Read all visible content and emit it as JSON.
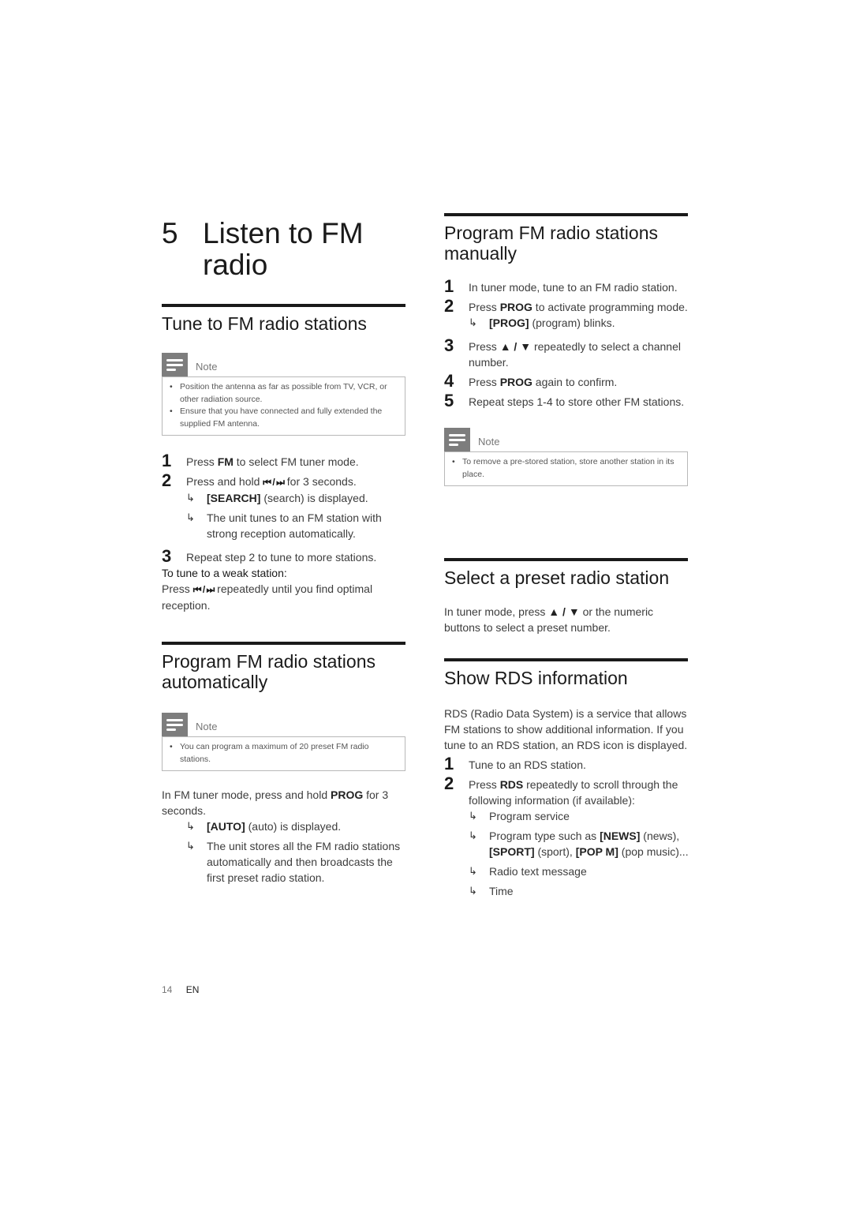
{
  "chapter": {
    "number": "5",
    "title": "Listen to FM radio"
  },
  "left": {
    "tune": {
      "heading": "Tune to FM radio stations",
      "note_label": "Note",
      "notes": [
        "Position the antenna as far as possible from TV, VCR, or other radiation source.",
        "Ensure that you have connected and fully extended the supplied FM antenna."
      ],
      "steps": [
        {
          "num": "1",
          "pre": "Press ",
          "key": "FM",
          "post": " to select FM tuner mode."
        },
        {
          "num": "2",
          "pre": "Press and hold ",
          "key": "⏮ / ⏭",
          "post": " for 3 seconds."
        },
        {
          "num": "3",
          "text": "Repeat step 2 to tune to more stations."
        }
      ],
      "step2_results": [
        {
          "key": "[SEARCH]",
          "text": " (search) is displayed."
        },
        {
          "text": "The unit tunes to an FM station with strong reception automatically."
        }
      ],
      "weak_heading": "To tune to a weak station:",
      "weak_pre": "Press ",
      "weak_key": "⏮ / ⏭",
      "weak_post": " repeatedly until you find optimal reception."
    },
    "auto": {
      "heading": "Program FM radio stations automatically",
      "note_label": "Note",
      "notes": [
        "You can program a maximum of 20 preset FM radio stations."
      ],
      "intro_pre": "In FM tuner mode, press and hold ",
      "intro_key": "PROG",
      "intro_post": " for 3 seconds.",
      "results": [
        {
          "key": "[AUTO]",
          "text": " (auto) is displayed."
        },
        {
          "text": "The unit stores all the FM radio stations automatically and then broadcasts the first preset radio station."
        }
      ]
    }
  },
  "right": {
    "manual": {
      "heading": "Program FM radio stations manually",
      "steps": [
        {
          "num": "1",
          "text": "In tuner mode, tune to an FM radio station."
        },
        {
          "num": "2",
          "pre": "Press ",
          "key": "PROG",
          "post": " to activate programming mode."
        },
        {
          "num": "3",
          "pre": "Press ",
          "key": "▲ / ▼",
          "post": " repeatedly to select a channel number."
        },
        {
          "num": "4",
          "pre": "Press ",
          "key": "PROG",
          "post": " again to confirm."
        },
        {
          "num": "5",
          "text": "Repeat steps 1-4 to store other FM stations."
        }
      ],
      "step2_result": {
        "key": "[PROG]",
        "text": " (program) blinks."
      },
      "note_label": "Note",
      "notes": [
        "To remove a pre-stored station, store another station in its place."
      ]
    },
    "preset": {
      "heading": "Select a preset radio station",
      "pre": "In tuner mode, press ",
      "key": "▲ / ▼",
      "post": " or the numeric buttons to select a preset number."
    },
    "rds": {
      "heading": "Show RDS information",
      "intro": "RDS (Radio Data System) is a service that allows FM stations to show additional information. If you tune to an RDS station, an RDS icon is displayed.",
      "steps": [
        {
          "num": "1",
          "text": "Tune to an RDS station."
        },
        {
          "num": "2",
          "pre": "Press ",
          "key": "RDS",
          "post": " repeatedly to scroll through the following information (if available):"
        }
      ],
      "results": [
        {
          "text": "Program service"
        },
        {
          "pre": "Program type such as ",
          "k1": "[NEWS]",
          "t1": " (news), ",
          "k2": "[SPORT]",
          "t2": " (sport), ",
          "k3": "[POP M]",
          "t3": " (pop music)..."
        },
        {
          "text": "Radio text message"
        },
        {
          "text": "Time"
        }
      ]
    }
  },
  "footer": {
    "page": "14",
    "lang": "EN"
  },
  "icons": {
    "note": "note-lines-icon",
    "result_arrow": "↳"
  }
}
